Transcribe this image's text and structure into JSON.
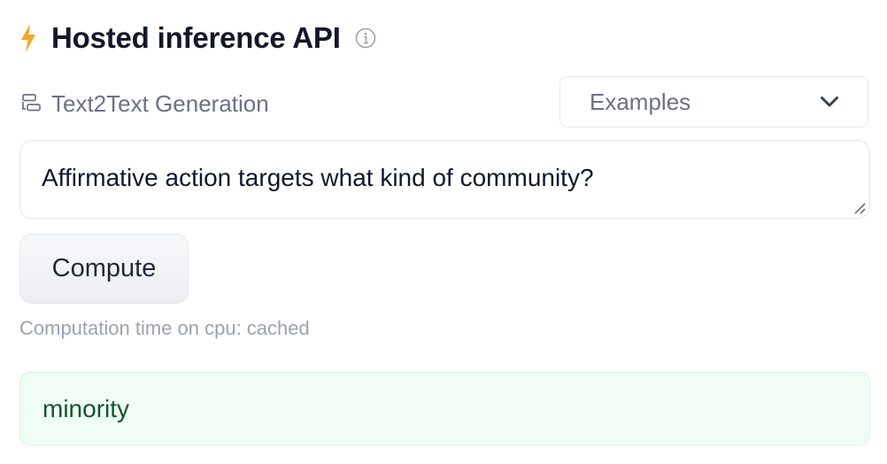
{
  "header": {
    "icon": "lightning-bolt-icon",
    "title": "Hosted inference API",
    "info_icon": "info-icon"
  },
  "task": {
    "icon": "text2text-icon",
    "label": "Text2Text Generation"
  },
  "examples": {
    "label": "Examples",
    "icon": "chevron-down-icon"
  },
  "input": {
    "value": "Affirmative action targets what kind of community?"
  },
  "compute": {
    "label": "Compute"
  },
  "computation_time": "Computation time on cpu: cached",
  "output": {
    "text": "minority"
  },
  "colors": {
    "bolt": "#f5a524",
    "output_bg": "#f0fdf4",
    "output_text": "#14532d"
  }
}
